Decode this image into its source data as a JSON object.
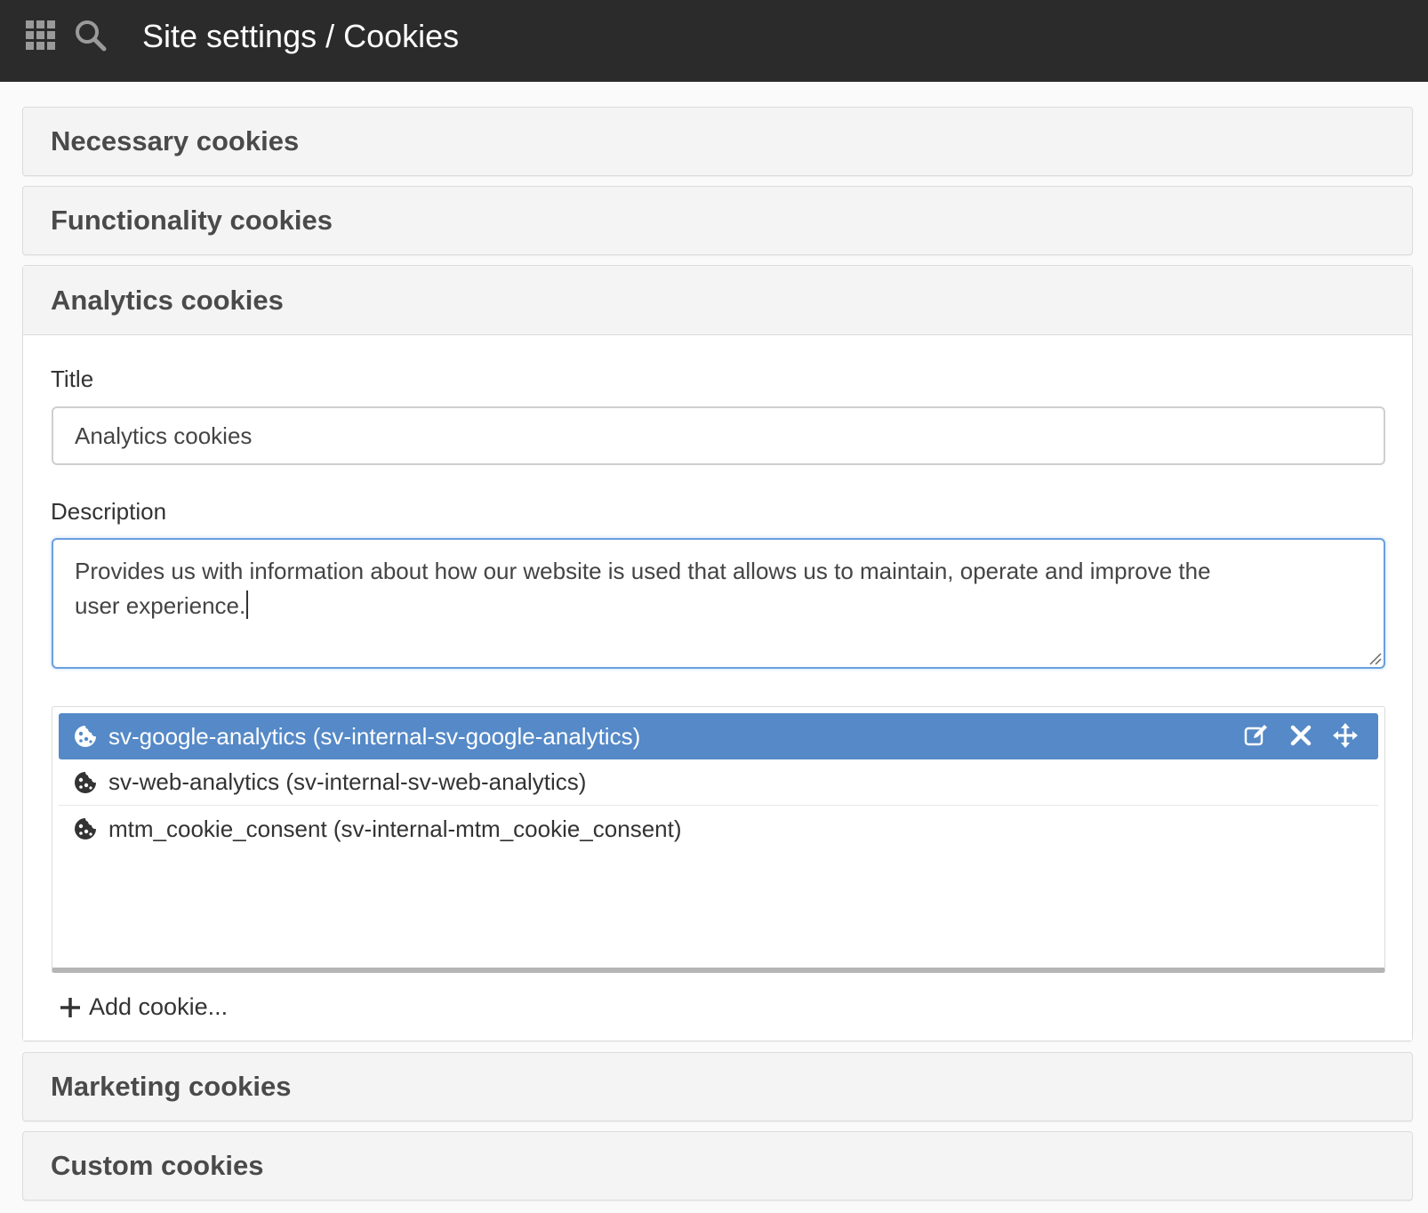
{
  "header": {
    "breadcrumb": "Site settings / Cookies",
    "icons": [
      "apps-grid-icon",
      "search-icon"
    ]
  },
  "panels": [
    {
      "title": "Necessary cookies",
      "expanded": false
    },
    {
      "title": "Functionality cookies",
      "expanded": false
    },
    {
      "title": "Analytics cookies",
      "expanded": true,
      "form": {
        "title_label": "Title",
        "title_value": "Analytics cookies",
        "description_label": "Description",
        "description_value": "Provides us with information about how our website is used that allows us to maintain, operate and improve the user experience.",
        "description_line1": "Provides us with information about how our website is used that allows us to maintain, operate and improve the",
        "description_line2": "user experience."
      },
      "cookies": [
        {
          "label": "sv-google-analytics (sv-internal-sv-google-analytics)",
          "selected": true
        },
        {
          "label": "sv-web-analytics (sv-internal-sv-web-analytics)",
          "selected": false
        },
        {
          "label": "mtm_cookie_consent (sv-internal-mtm_cookie_consent)",
          "selected": false
        }
      ],
      "item_actions": [
        "edit-icon",
        "remove-icon",
        "move-icon"
      ],
      "add_label": "Add cookie..."
    },
    {
      "title": "Marketing cookies",
      "expanded": false
    },
    {
      "title": "Custom cookies",
      "expanded": false
    }
  ],
  "colors": {
    "topbar": "#2b2b2b",
    "selected_row": "#5589c7",
    "focus_border": "#6aa0dd"
  }
}
